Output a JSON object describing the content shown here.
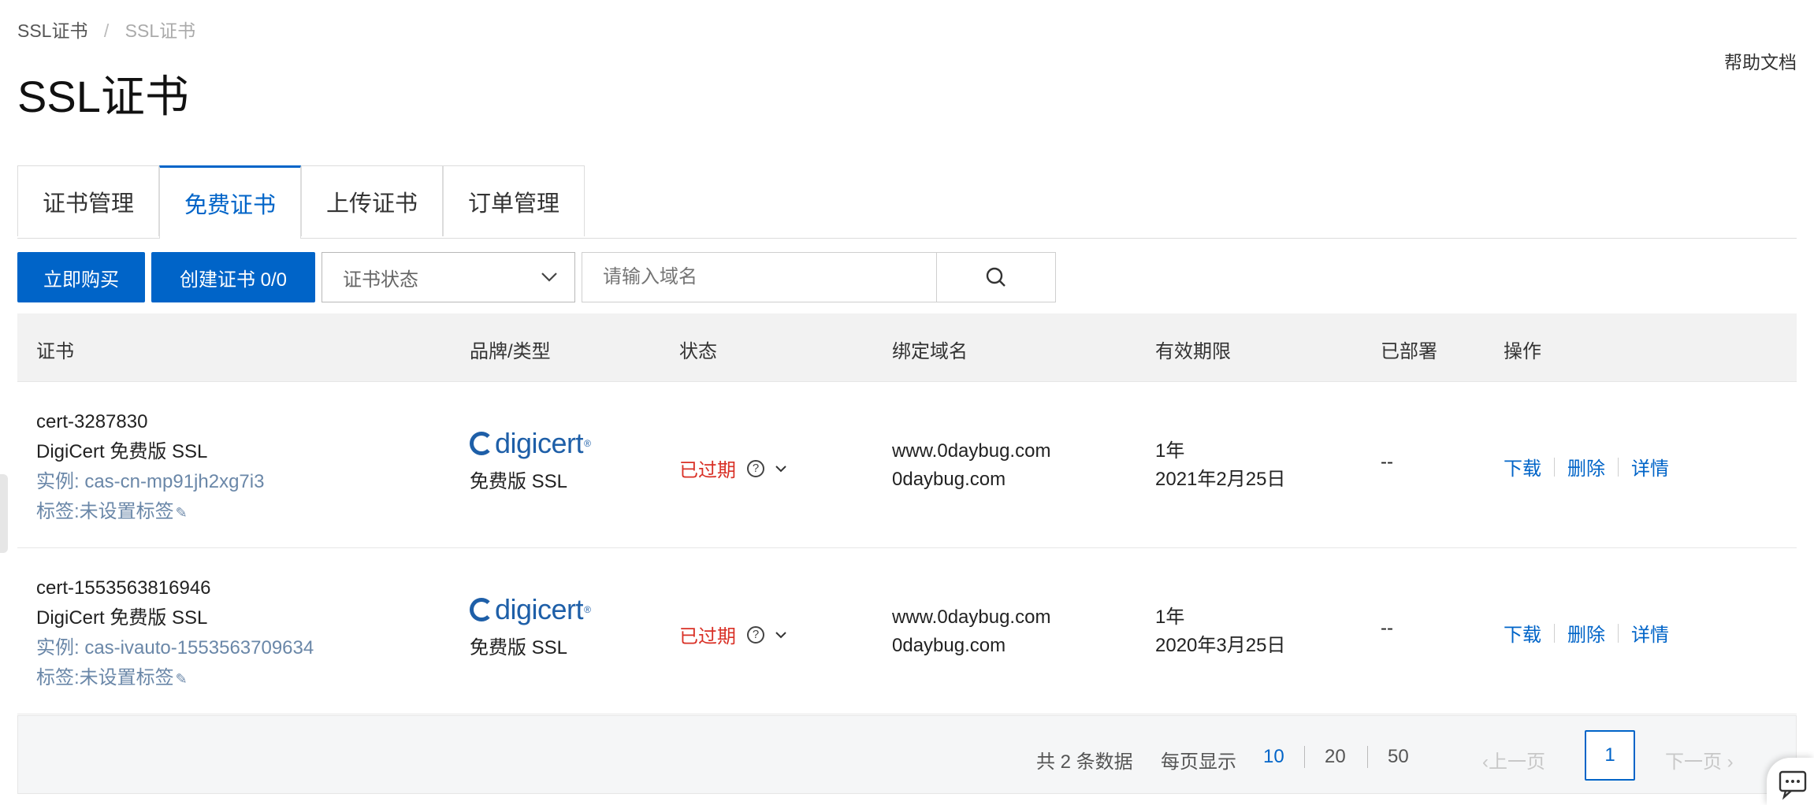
{
  "breadcrumb": [
    "SSL证书",
    "SSL证书"
  ],
  "help_link": "帮助文档",
  "page_title": "SSL证书",
  "tabs": [
    {
      "label": "证书管理",
      "active": false
    },
    {
      "label": "免费证书",
      "active": true
    },
    {
      "label": "上传证书",
      "active": false
    },
    {
      "label": "订单管理",
      "active": false
    }
  ],
  "toolbar": {
    "buy_label": "立即购买",
    "create_label": "创建证书 0/0",
    "status_select": "证书状态",
    "search_placeholder": "请输入域名",
    "search_icon": "search-icon"
  },
  "table": {
    "headers": [
      "证书",
      "品牌/类型",
      "状态",
      "绑定域名",
      "有效期限",
      "已部署",
      "操作"
    ],
    "rows": [
      {
        "cert_id": "cert-3287830",
        "cert_title": "DigiCert 免费版 SSL",
        "instance": "实例: cas-cn-mp91jh2xg7i3",
        "tags": "标签:未设置标签",
        "brand": "digicert",
        "brand_type": "免费版 SSL",
        "status": "已过期",
        "domains": [
          "www.0daybug.com",
          "0daybug.com"
        ],
        "validity": [
          "1年",
          "2021年2月25日"
        ],
        "deployed": "--",
        "ops": [
          "下载",
          "删除",
          "详情"
        ]
      },
      {
        "cert_id": "cert-1553563816946",
        "cert_title": "DigiCert 免费版 SSL",
        "instance": "实例: cas-ivauto-1553563709634",
        "tags": "标签:未设置标签",
        "brand": "digicert",
        "brand_type": "免费版 SSL",
        "status": "已过期",
        "domains": [
          "www.0daybug.com",
          "0daybug.com"
        ],
        "validity": [
          "1年",
          "2020年3月25日"
        ],
        "deployed": "--",
        "ops": [
          "下载",
          "删除",
          "详情"
        ]
      }
    ]
  },
  "pagination": {
    "total": "共 2 条数据",
    "per_page_label": "每页显示",
    "sizes": [
      "10",
      "20",
      "50"
    ],
    "selected_size": "10",
    "prev": "上一页",
    "current_page": "1",
    "next": "下一页"
  },
  "colors": {
    "accent": "#0064c8",
    "expired": "#d93026",
    "link_muted": "#6a87a8"
  }
}
